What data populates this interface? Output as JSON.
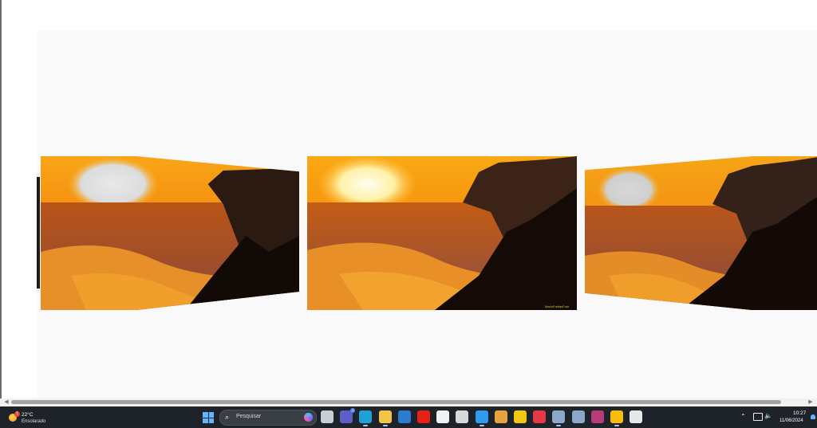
{
  "slider": {
    "slides": [
      {
        "position": "left",
        "watermark": ""
      },
      {
        "position": "center",
        "watermark": "MarioFreitasFoto"
      },
      {
        "position": "right",
        "watermark": ""
      }
    ]
  },
  "taskbar": {
    "weather": {
      "temperature": "22°C",
      "condition": "Ensolarado",
      "badge": "1"
    },
    "search_placeholder": "Pesquisar",
    "apps": [
      {
        "name": "task-view-icon",
        "color": "#c9ced6"
      },
      {
        "name": "teams-icon",
        "color": "#5b5fc7",
        "badge": "1"
      },
      {
        "name": "edge-icon",
        "color": "#1fa0d6",
        "active": true
      },
      {
        "name": "file-explorer-icon",
        "color": "#f4c542",
        "active": true
      },
      {
        "name": "mail-icon",
        "color": "#2b7cd3"
      },
      {
        "name": "youtube-icon",
        "color": "#e62117"
      },
      {
        "name": "store-icon",
        "color": "#f2f2f2"
      },
      {
        "name": "davinci-icon",
        "color": "#d8d8d8"
      },
      {
        "name": "vscode-icon",
        "color": "#2d9cf0",
        "active": true
      },
      {
        "name": "git-icon",
        "color": "#e8a33d"
      },
      {
        "name": "powerbi-icon",
        "color": "#f2c811"
      },
      {
        "name": "app-red-icon",
        "color": "#e63946"
      },
      {
        "name": "pgadmin-icon",
        "color": "#8aa8c9",
        "active": true
      },
      {
        "name": "pgadmin-2-icon",
        "color": "#8aa8c9"
      },
      {
        "name": "winrar-icon",
        "color": "#b73a7a"
      },
      {
        "name": "chrome-icon",
        "color": "#fbbc05",
        "active": true
      },
      {
        "name": "snipping-icon",
        "color": "#e8e8e8"
      }
    ],
    "clock": {
      "time": "10:27",
      "date": "11/06/2024"
    }
  }
}
